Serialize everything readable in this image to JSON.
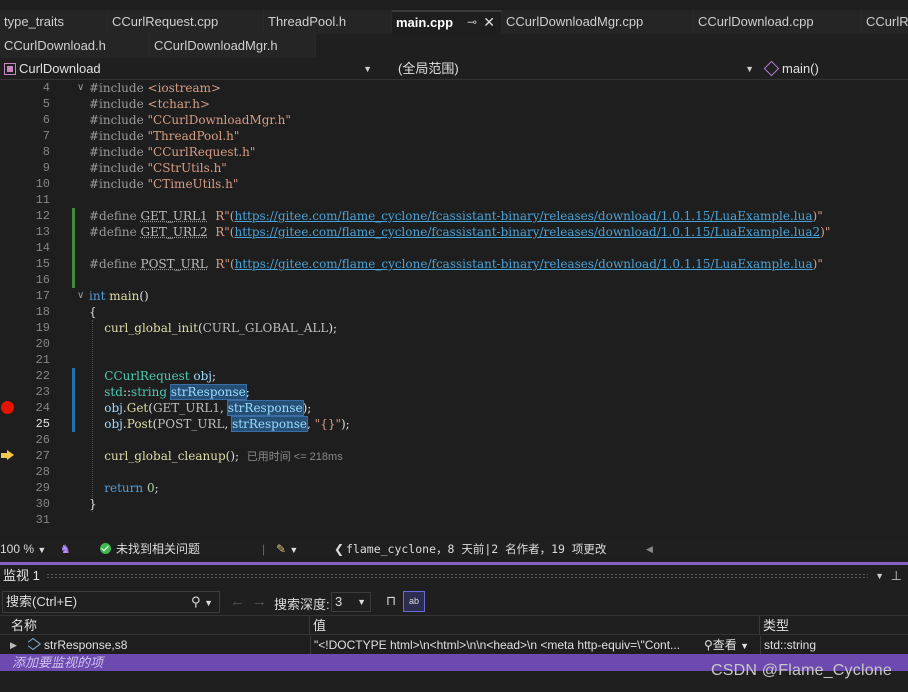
{
  "tabs_row1": [
    {
      "label": "type_traits",
      "active": false
    },
    {
      "label": "CCurlRequest.cpp",
      "active": false
    },
    {
      "label": "ThreadPool.h",
      "active": false
    },
    {
      "label": "main.cpp",
      "active": true
    },
    {
      "label": "CCurlDownloadMgr.cpp",
      "active": false
    },
    {
      "label": "CCurlDownload.cpp",
      "active": false
    },
    {
      "label": "CCurlR",
      "active": false
    }
  ],
  "tabs_row2": [
    {
      "label": "CCurlDownload.h"
    },
    {
      "label": "CCurlDownloadMgr.h"
    }
  ],
  "navbar": {
    "project": "CurlDownload",
    "scope": "(全局范围)",
    "member": "main()"
  },
  "editor": {
    "current_line": 25,
    "perf_tip": "已用时间 <= 218ms",
    "lines": [
      {
        "n": 4,
        "text": "#include <iostream>"
      },
      {
        "n": 5,
        "text": "#include <tchar.h>"
      },
      {
        "n": 6,
        "text": "#include \"CCurlDownloadMgr.h\""
      },
      {
        "n": 7,
        "text": "#include \"ThreadPool.h\""
      },
      {
        "n": 8,
        "text": "#include \"CCurlRequest.h\""
      },
      {
        "n": 9,
        "text": "#include \"CStrUtils.h\""
      },
      {
        "n": 10,
        "text": "#include \"CTimeUtils.h\""
      },
      {
        "n": 11,
        "text": ""
      },
      {
        "n": 12,
        "text": "#define GET_URL1  R\"(https://gitee.com/flame_cyclone/fcassistant-binary/releases/download/1.0.1.15/LuaExample.lua)\""
      },
      {
        "n": 13,
        "text": "#define GET_URL2  R\"(https://gitee.com/flame_cyclone/fcassistant-binary/releases/download/1.0.1.15/LuaExample.lua2)\""
      },
      {
        "n": 14,
        "text": ""
      },
      {
        "n": 15,
        "text": "#define POST_URL  R\"(https://gitee.com/flame_cyclone/fcassistant-binary/releases/download/1.0.1.15/LuaExample.lua)\""
      },
      {
        "n": 16,
        "text": ""
      },
      {
        "n": 17,
        "text": "int main()"
      },
      {
        "n": 18,
        "text": "{"
      },
      {
        "n": 19,
        "text": "curl_global_init(CURL_GLOBAL_ALL);"
      },
      {
        "n": 20,
        "text": ""
      },
      {
        "n": 21,
        "text": ""
      },
      {
        "n": 22,
        "text": "CCurlRequest obj;"
      },
      {
        "n": 23,
        "text": "std::string strResponse;"
      },
      {
        "n": 24,
        "text": "obj.Get(GET_URL1, strResponse);"
      },
      {
        "n": 25,
        "text": "obj.Post(POST_URL, strResponse, \"{}\");"
      },
      {
        "n": 26,
        "text": ""
      },
      {
        "n": 27,
        "text": "curl_global_cleanup();"
      },
      {
        "n": 28,
        "text": ""
      },
      {
        "n": 29,
        "text": "return 0;"
      },
      {
        "n": 30,
        "text": "}"
      },
      {
        "n": 31,
        "text": ""
      }
    ]
  },
  "statusbar": {
    "zoom": "100 %",
    "issues": "未找到相关问题",
    "git_blame": "flame_cyclone，8 天前|2 名作者，19 项更改"
  },
  "watch": {
    "title": "监视 1",
    "search_placeholder": "搜索(Ctrl+E)",
    "depth_label": "搜索深度:",
    "depth_value": "3",
    "columns": {
      "name": "名称",
      "value": "值",
      "type": "类型"
    },
    "row": {
      "name": "strResponse,s8",
      "value": "\"<!DOCTYPE html>\\n<html>\\n\\n<head>\\n  <meta http-equiv=\\\"Cont...",
      "view_label": "查看",
      "type": "std::string"
    },
    "add_item": "添加要监视的项"
  },
  "watermark": "CSDN @Flame_Cyclone",
  "colors": {
    "accent_purple": "#8660c5",
    "selection_purple": "#6c4ab0",
    "breakpoint_red": "#e51400",
    "change_green": "#3c8a3c",
    "change_blue": "#1f6fb3"
  }
}
